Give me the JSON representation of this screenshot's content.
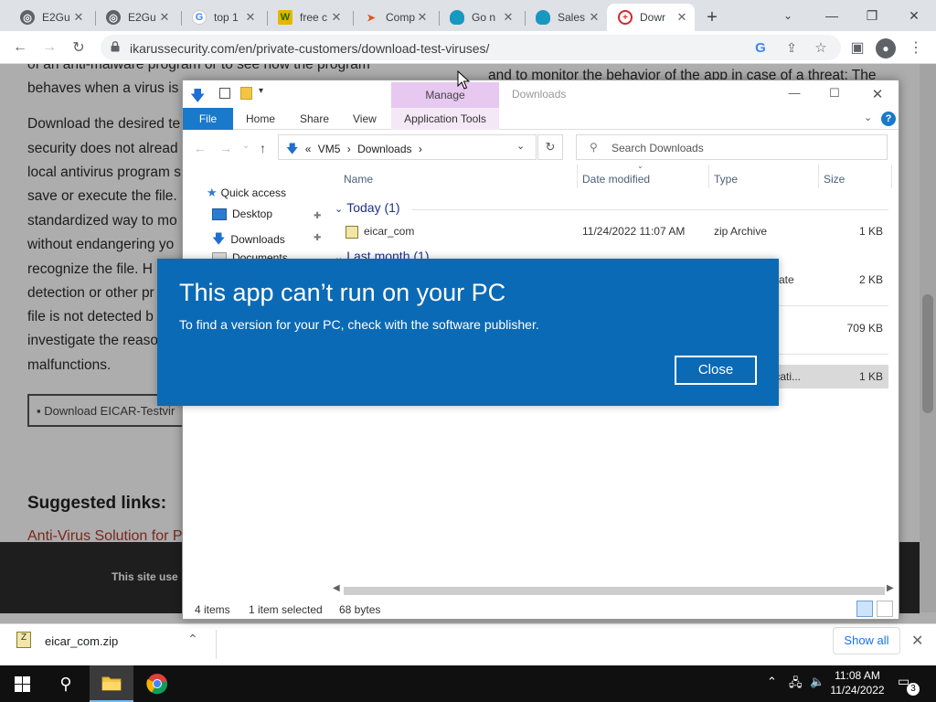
{
  "browser": {
    "tabs": [
      {
        "title": "E2Gu",
        "favicon": "chrome-icon"
      },
      {
        "title": "E2Gu",
        "favicon": "chrome-icon"
      },
      {
        "title": "top 1",
        "favicon": "google-icon"
      },
      {
        "title": "free c",
        "favicon": "w-icon"
      },
      {
        "title": "Comp",
        "favicon": "arrow-icon"
      },
      {
        "title": "Go n",
        "favicon": "cloud-icon"
      },
      {
        "title": "Sales",
        "favicon": "cloud-icon"
      },
      {
        "title": "Dowr",
        "favicon": "ikarus-icon",
        "active": true
      }
    ],
    "new_tab": "+",
    "url": "ikarussecurity.com/en/private-customers/download-test-viruses/"
  },
  "webpage": {
    "lines": [
      "of an anti-malware program or to see how the program",
      "behaves when a virus is",
      "Download the desired te",
      "security does not alread",
      "local antivirus program s",
      "save or execute the file.",
      "standardized way to mo",
      "without endangering yo",
      "recognize the file. H",
      "detection or other pr",
      "file is not detected b",
      "investigate the reaso",
      "malfunctions."
    ],
    "right_snippet": "and to monitor the behavior of the app in case of a threat: The",
    "download_button": "Download EICAR-Testvir",
    "suggested_heading": "Suggested links:",
    "suggested_link": "Anti-Virus Solution for P",
    "cookie_text": "This site use"
  },
  "download_bar": {
    "file": "eicar_com.zip",
    "show_all": "Show all"
  },
  "explorer": {
    "title": "Downloads",
    "manage": "Manage",
    "ribbon": {
      "file": "File",
      "home": "Home",
      "share": "Share",
      "view": "View",
      "app_tools": "Application Tools"
    },
    "address": {
      "prefix": "«",
      "part1": "VM5",
      "sep": "›",
      "part2": "Downloads",
      "sep2": "›"
    },
    "search_placeholder": "Search Downloads",
    "nav": {
      "quick_access": "Quick access",
      "desktop": "Desktop",
      "downloads": "Downloads",
      "documents": "Documents"
    },
    "columns": {
      "name": "Name",
      "date": "Date modified",
      "type": "Type",
      "size": "Size"
    },
    "groups": {
      "today": "Today (1)",
      "last_month": "Last month (1)"
    },
    "rows": [
      {
        "name": "eicar_com",
        "date": "11/24/2022 11:07 AM",
        "type": "zip Archive",
        "size": "1 KB"
      },
      {
        "type": "ficate",
        "size": "2 KB"
      },
      {
        "size": "709 KB"
      },
      {
        "type": "licati...",
        "size": "1 KB"
      }
    ],
    "status": {
      "items": "4 items",
      "selected": "1 item selected",
      "bytes": "68 bytes"
    }
  },
  "dialog": {
    "title": "This app can’t run on your PC",
    "message": "To find a version for your PC, check with the software publisher.",
    "close": "Close"
  },
  "taskbar": {
    "time": "11:08 AM",
    "date": "11/24/2022",
    "notifications": "3"
  }
}
